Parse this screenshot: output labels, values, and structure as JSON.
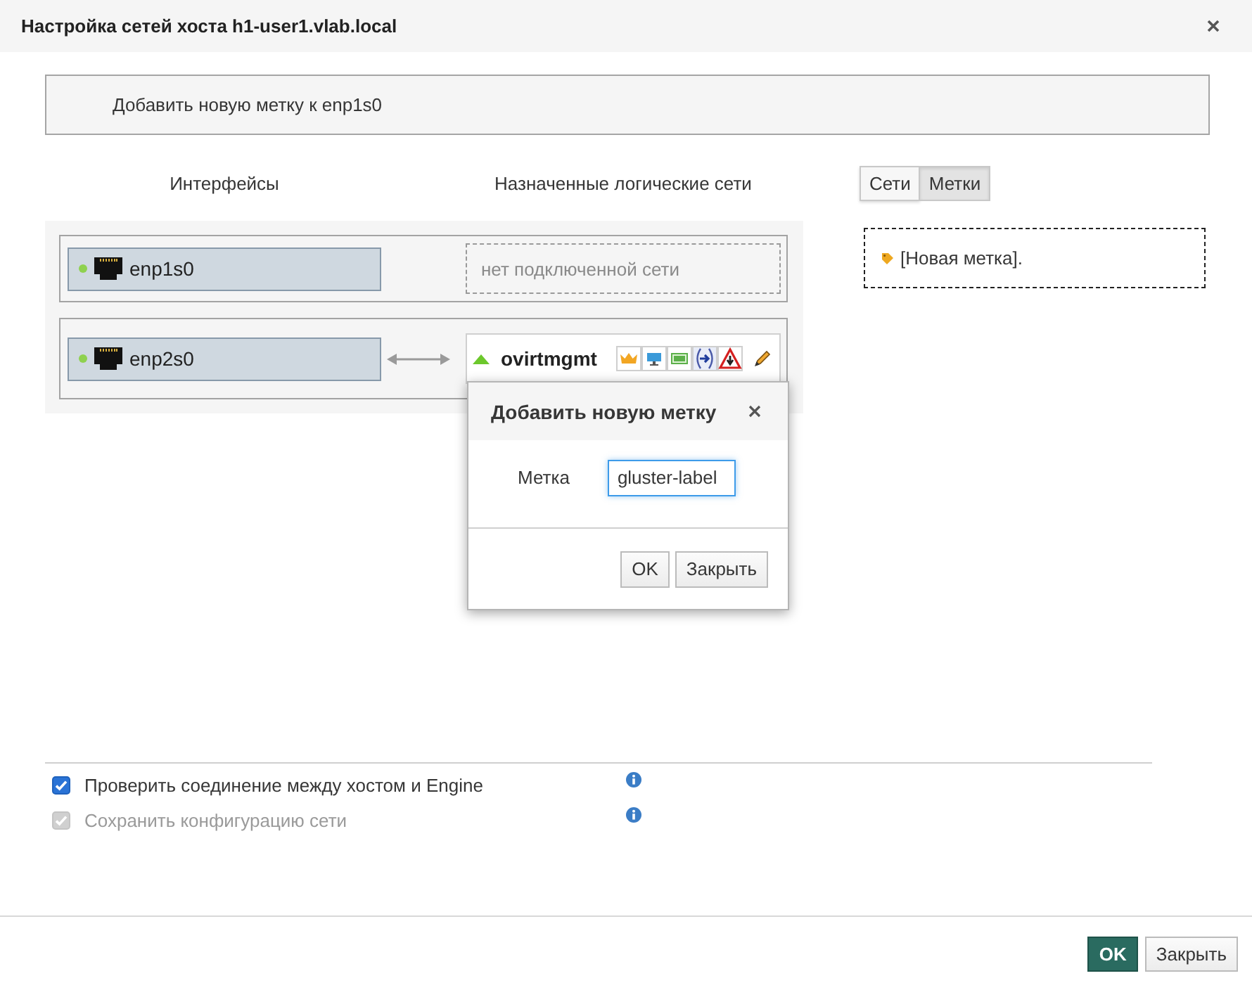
{
  "window": {
    "title": "Настройка сетей хоста h1-user1.vlab.local"
  },
  "info_message": "Добавить новую метку к enp1s0",
  "column_headers": [
    "Интерфейсы",
    "Назначенные логические сети"
  ],
  "view_tabs": [
    {
      "label": "Сети",
      "selected": false
    },
    {
      "label": "Метки",
      "selected": true
    }
  ],
  "interfaces": [
    {
      "name": "enp1s0",
      "link_up": true,
      "assigned": {
        "kind": "empty",
        "text": "нет подключенной сети"
      }
    },
    {
      "name": "enp2s0",
      "link_up": true,
      "assigned": {
        "kind": "network",
        "name": "ovirtmgmt",
        "status_up": true,
        "role_icons": [
          {
            "kind": "crown"
          },
          {
            "kind": "monitor"
          },
          {
            "kind": "vm"
          },
          {
            "kind": "migration"
          },
          {
            "kind": "warning"
          }
        ]
      }
    }
  ],
  "labels": [
    {
      "text": "[Новая метка]."
    }
  ],
  "add_label_dialog": {
    "title": "Добавить новую метку",
    "field_label": "Метка",
    "value": "gluster-label",
    "focused": true,
    "buttons": [
      "OK",
      "Закрыть"
    ]
  },
  "options": [
    {
      "label": "Проверить соединение между хостом и Engine",
      "checked": true,
      "disabled": false
    },
    {
      "label": "Сохранить конфигурацию сети",
      "checked": true,
      "disabled": true
    }
  ],
  "footer_buttons": [
    {
      "label": "OK",
      "kind": "primary"
    },
    {
      "label": "Закрыть",
      "kind": "default"
    }
  ]
}
